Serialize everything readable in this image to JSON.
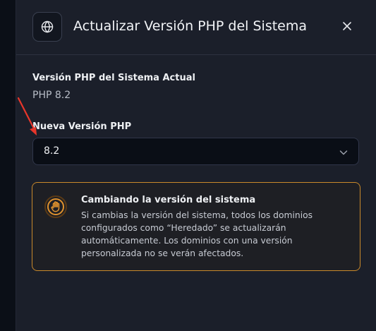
{
  "modal": {
    "title": "Actualizar Versión PHP del Sistema",
    "icon": "globe-icon",
    "close_icon": "close-icon"
  },
  "current_version": {
    "label": "Versión PHP del Sistema Actual",
    "value": "PHP 8.2"
  },
  "new_version": {
    "label": "Nueva Versión PHP",
    "selected": "8.2",
    "chevron_icon": "chevron-down-icon"
  },
  "alert": {
    "icon": "hand-icon",
    "title": "Cambiando la versión del sistema",
    "body": "Si cambias la versión del sistema, todos los dominios configurados como “Heredado” se actualizarán automáticamente. Los dominios con una versión personalizada no se verán afectados."
  },
  "colors": {
    "alert_border": "#c9892b",
    "alert_icon": "#e0922e",
    "annotation_arrow": "#e8362a"
  }
}
